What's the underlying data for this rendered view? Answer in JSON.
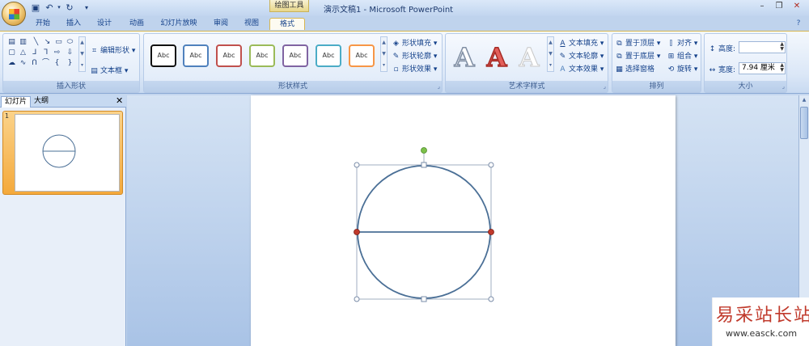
{
  "app": {
    "title": "演示文稿1 - Microsoft PowerPoint",
    "context_tab": "绘图工具"
  },
  "tabs": [
    "开始",
    "插入",
    "设计",
    "动画",
    "幻灯片放映",
    "审阅",
    "视图",
    "格式"
  ],
  "active_tab": "格式",
  "ribbon": {
    "insert_shapes": {
      "label": "插入形状",
      "edit_shape": "编辑形状",
      "text_box": "文本框"
    },
    "shape_styles": {
      "label": "形状样式",
      "sample_text": "Abc",
      "fill": "形状填充",
      "outline": "形状轮廓",
      "effects": "形状效果"
    },
    "wordart": {
      "label": "艺术字样式",
      "text_fill": "文本填充",
      "text_outline": "文本轮廓",
      "text_effects": "文本效果"
    },
    "arrange": {
      "label": "排列",
      "bring_front": "置于顶层",
      "send_back": "置于底层",
      "selection_pane": "选择窗格",
      "align": "对齐",
      "group": "组合",
      "rotate": "旋转"
    },
    "size": {
      "label": "大小",
      "height_label": "高度:",
      "height_value": "",
      "width_label": "宽度:",
      "width_value": "7.94 厘米"
    }
  },
  "panel": {
    "tab_slides": "幻灯片",
    "tab_outline": "大纲",
    "slide_number": "1"
  },
  "watermark": {
    "cn": "易采站长站",
    "url": "www.easck.com"
  },
  "colors": {
    "shape_stroke": "#4a6f96",
    "handle_red": "#c0392b",
    "rotation_green": "#7cc04a",
    "watermark_red": "#c0392b"
  }
}
